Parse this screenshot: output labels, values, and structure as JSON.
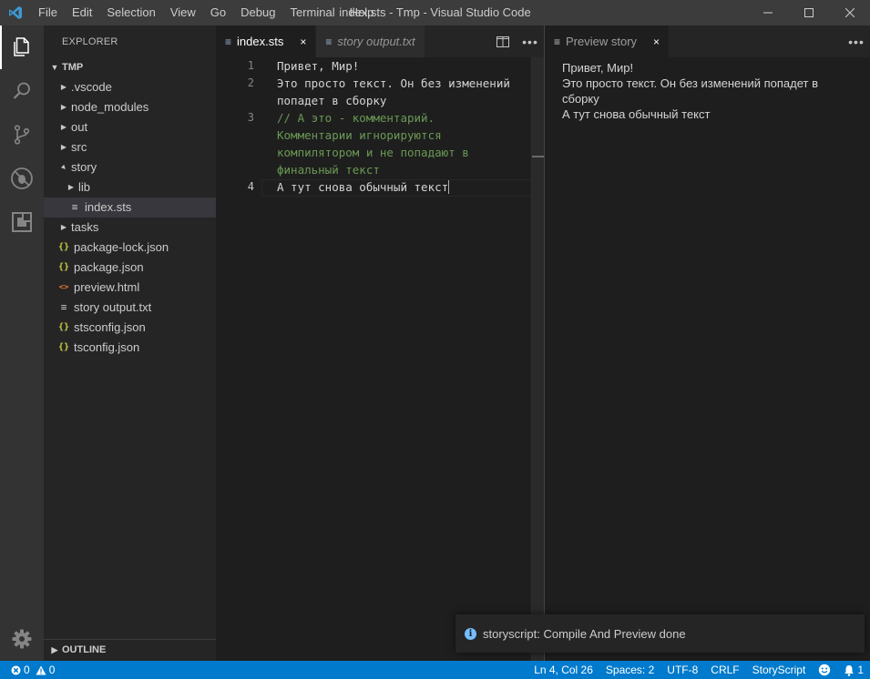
{
  "titlebar": {
    "menu": [
      "File",
      "Edit",
      "Selection",
      "View",
      "Go",
      "Debug",
      "Terminal",
      "Help"
    ],
    "title": "index.sts - Tmp - Visual Studio Code"
  },
  "activitybar": {
    "icons": [
      "explorer-icon",
      "search-icon",
      "source-control-icon",
      "debug-icon",
      "extensions-icon",
      "gear-icon"
    ]
  },
  "sidebar": {
    "title": "EXPLORER",
    "root": "TMP",
    "items": [
      {
        "label": ".vscode",
        "kind": "folder",
        "depth": 1,
        "expanded": false
      },
      {
        "label": "node_modules",
        "kind": "folder",
        "depth": 1,
        "expanded": false
      },
      {
        "label": "out",
        "kind": "folder",
        "depth": 1,
        "expanded": false
      },
      {
        "label": "src",
        "kind": "folder",
        "depth": 1,
        "expanded": false
      },
      {
        "label": "story",
        "kind": "folder",
        "depth": 1,
        "expanded": true
      },
      {
        "label": "lib",
        "kind": "folder",
        "depth": 2,
        "expanded": false
      },
      {
        "label": "index.sts",
        "kind": "file",
        "depth": 2,
        "icon": "lines",
        "selected": true
      },
      {
        "label": "tasks",
        "kind": "folder",
        "depth": 1,
        "expanded": false
      },
      {
        "label": "package-lock.json",
        "kind": "file",
        "depth": 1,
        "icon": "json"
      },
      {
        "label": "package.json",
        "kind": "file",
        "depth": 1,
        "icon": "json"
      },
      {
        "label": "preview.html",
        "kind": "file",
        "depth": 1,
        "icon": "html"
      },
      {
        "label": "story output.txt",
        "kind": "file",
        "depth": 1,
        "icon": "lines"
      },
      {
        "label": "stsconfig.json",
        "kind": "file",
        "depth": 1,
        "icon": "json"
      },
      {
        "label": "tsconfig.json",
        "kind": "file",
        "depth": 1,
        "icon": "json"
      }
    ],
    "outline": "OUTLINE"
  },
  "editor1": {
    "tabs": [
      {
        "label": "index.sts",
        "active": true,
        "close": "×"
      },
      {
        "label": "story output.txt",
        "active": false
      }
    ],
    "lines": [
      {
        "num": "1",
        "text": "Привет, Мир!",
        "comment": false
      },
      {
        "num": "2",
        "text": "Это просто текст. Он без изменений",
        "comment": false
      },
      {
        "num": "",
        "text": "попадет в сборку",
        "comment": false
      },
      {
        "num": "3",
        "text": "// А это - комментарий.",
        "comment": true
      },
      {
        "num": "",
        "text": "Комментарии игнорируются",
        "comment": true
      },
      {
        "num": "",
        "text": "компилятором и не попадают в",
        "comment": true
      },
      {
        "num": "",
        "text": "финальный текст",
        "comment": true
      },
      {
        "num": "4",
        "text": "А тут снова обычный текст",
        "comment": false,
        "current": true
      }
    ]
  },
  "editor2": {
    "tab": {
      "label": "Preview story",
      "close": "×"
    },
    "preview_lines": [
      "Привет, Мир!",
      "Это просто текст. Он без изменений попадет в сборку",
      "А тут снова обычный текст"
    ]
  },
  "notification": {
    "message": "storyscript: Compile And Preview done"
  },
  "statusbar": {
    "errors": "0",
    "warnings": "0",
    "position": "Ln 4, Col 26",
    "spaces": "Spaces: 2",
    "encoding": "UTF-8",
    "eol": "CRLF",
    "language": "StoryScript",
    "notifications": "1"
  },
  "colors": {
    "accent": "#007acc",
    "comment": "#6a9955",
    "json_icon": "#cbcb41",
    "html_icon": "#e37933"
  }
}
